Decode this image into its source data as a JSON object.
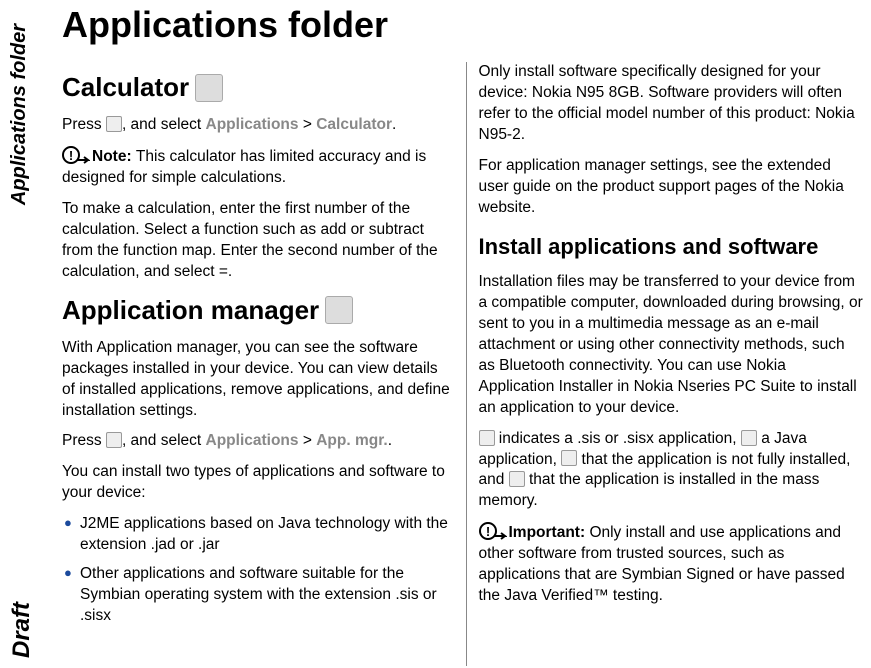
{
  "side_tab": "Applications folder",
  "draft_label": "Draft",
  "page_title": "Applications folder",
  "left": {
    "h2_calculator": "Calculator",
    "calc_press": "Press ",
    "calc_select": ", and select ",
    "calc_path1": "Applications",
    "calc_gt": " > ",
    "calc_path2": "Calculator",
    "calc_dot": ".",
    "note_label": "Note:  ",
    "note_text": "This calculator has limited accuracy and is designed for simple calculations.",
    "calc_para2": "To make a calculation, enter the first number of the calculation. Select a function such as add or subtract from the function map. Enter the second number of the calculation, and select =.",
    "h2_appmgr": "Application manager",
    "appmgr_p1": "With Application manager, you can see the software packages installed in your device. You can view details of installed applications, remove applications, and define installation settings.",
    "appmgr_press": "Press ",
    "appmgr_select": ", and select ",
    "appmgr_path1": "Applications",
    "appmgr_gt": " > ",
    "appmgr_path2": "App. mgr.",
    "appmgr_dot": ".",
    "appmgr_p3": "You can install two types of applications and software to your device:",
    "li1": "J2ME applications based on Java technology with the extension .jad or .jar",
    "li2": "Other applications and software suitable for the Symbian operating system with the extension .sis or .sisx"
  },
  "right": {
    "p1": "Only install software specifically designed for your device: Nokia N95 8GB. Software providers will often refer to the official model number of this product: Nokia N95-2.",
    "p2": "For application manager settings, see the extended user guide on the product support pages of the Nokia website.",
    "h3_install": "Install applications and software",
    "p3": "Installation files may be transferred to your device from a compatible computer, downloaded during browsing, or sent to you in a multimedia message as an e-mail attachment or using other connectivity methods, such as Bluetooth connectivity. You can use Nokia Application Installer in Nokia Nseries PC Suite to install an application to your device.",
    "p4a": " indicates a .sis or .sisx application, ",
    "p4b": " a Java application, ",
    "p4c": " that the application is not fully installed, and ",
    "p4d": " that the application is installed in the mass memory.",
    "imp_label": "Important:  ",
    "imp_text": "Only install and use applications and other software from trusted sources, such as applications that are Symbian Signed or have passed the Java Verified™ testing."
  }
}
